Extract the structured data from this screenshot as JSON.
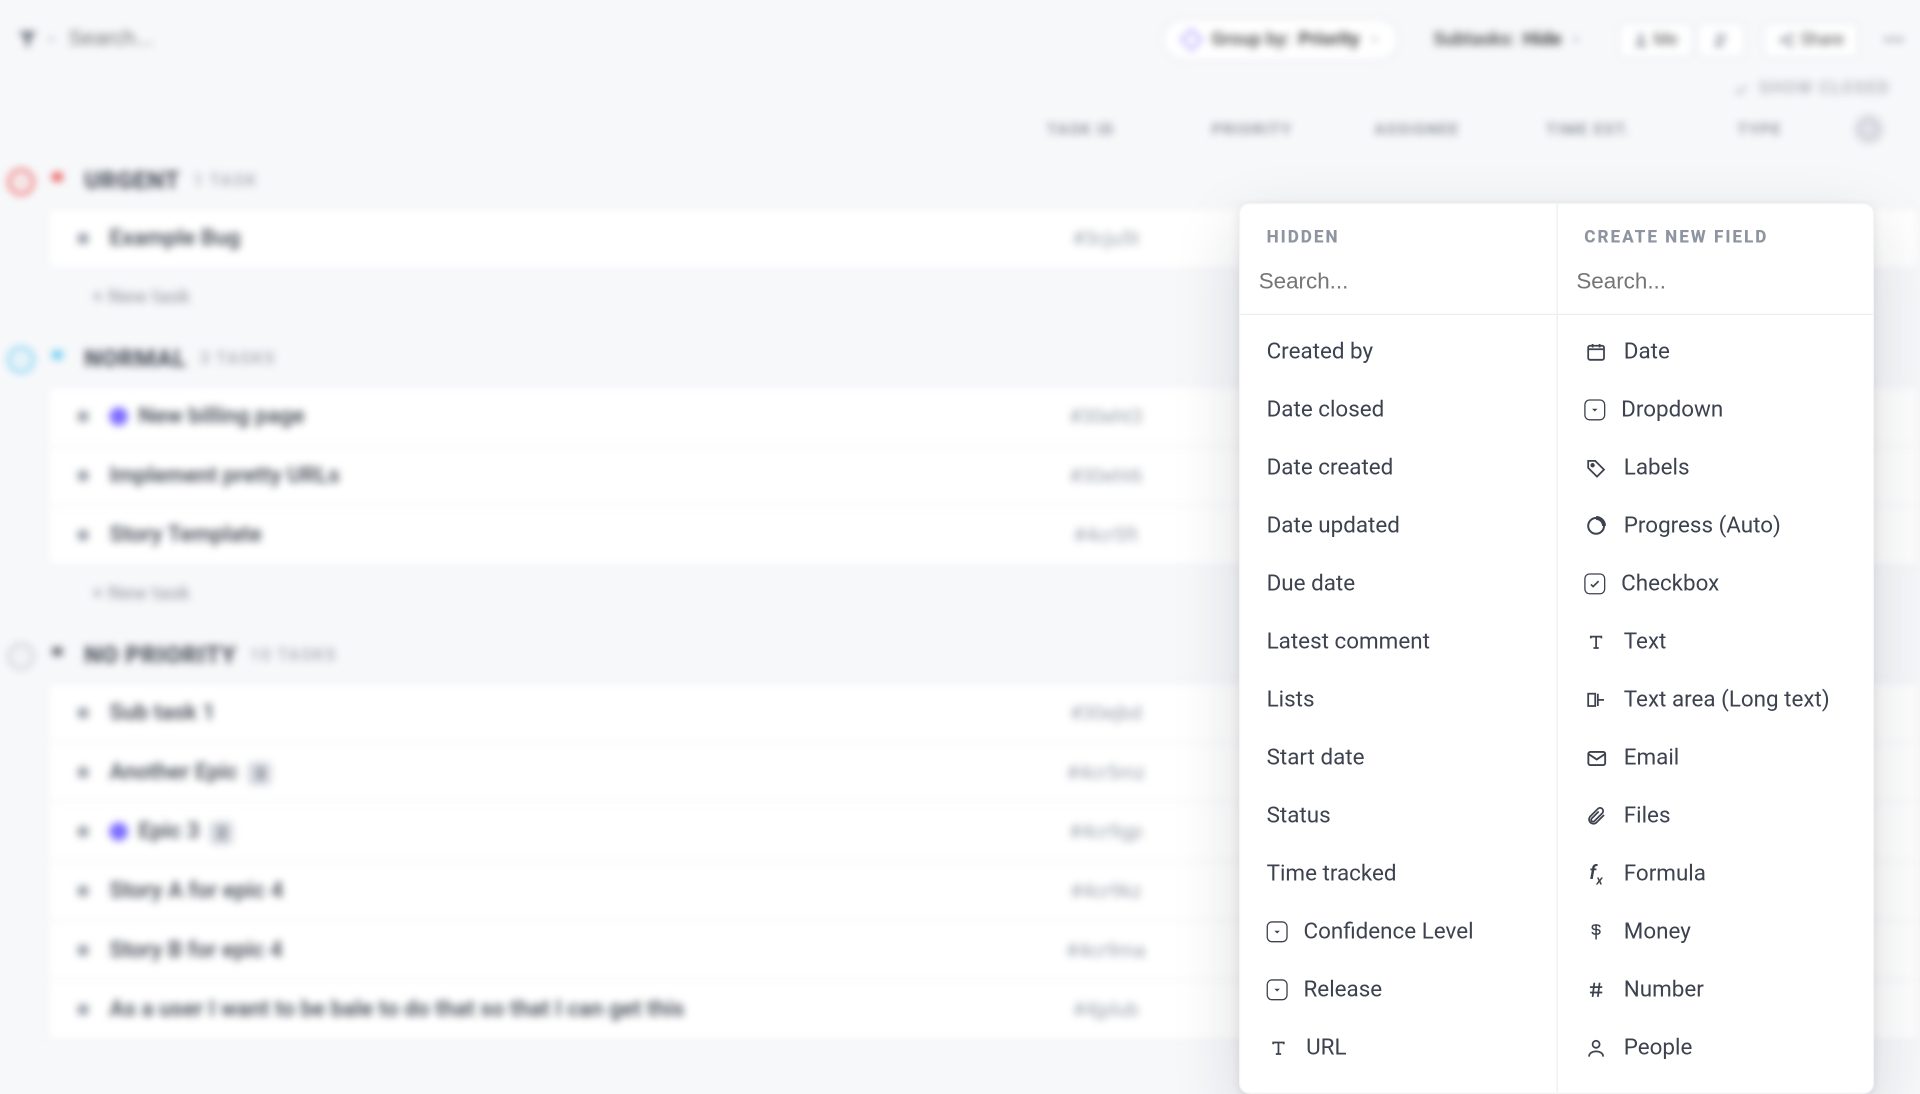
{
  "toolbar": {
    "search_placeholder": "Search...",
    "group_by_label": "Group by:",
    "group_by_value": "Priority",
    "subtasks_label": "Subtasks:",
    "subtasks_value": "Hide",
    "me": "Me",
    "share": "Share"
  },
  "subbar": {
    "show_closed": "SHOW CLOSED"
  },
  "columns": {
    "task_id": "TASK ID",
    "priority": "PRIORITY",
    "assignee": "ASSIGNEE",
    "time_est": "TIME EST.",
    "type": "TYPE"
  },
  "groups": [
    {
      "name": "URGENT",
      "count_label": "1 TASK",
      "flag": "red",
      "tasks": [
        {
          "title": "Example Bug",
          "id": "#3cju5t",
          "flag": "red",
          "badge": null,
          "dot": false
        }
      ]
    },
    {
      "name": "NORMAL",
      "count_label": "3 TASKS",
      "flag": "cyan",
      "tasks": [
        {
          "title": "New billing page",
          "id": "#30eht3",
          "flag": "cyan",
          "badge": null,
          "dot": true
        },
        {
          "title": "Implement pretty URLs",
          "id": "#30eht6",
          "flag": "cyan",
          "badge": null,
          "dot": false
        },
        {
          "title": "Story Template",
          "id": "#4cr5ft",
          "flag": "cyan",
          "badge": null,
          "dot": false
        }
      ]
    },
    {
      "name": "NO PRIORITY",
      "count_label": "10 TASKS",
      "flag": "grey",
      "tasks": [
        {
          "title": "Sub task 1",
          "id": "#30ejbd",
          "flag": "grey-outline",
          "badge": null,
          "dot": false
        },
        {
          "title": "Another Epic",
          "id": "#4cr5mz",
          "flag": "grey-outline",
          "badge": "3",
          "dot": false
        },
        {
          "title": "Epic 3",
          "id": "#4cr9gp",
          "flag": "grey-outline",
          "badge": "2",
          "dot": true
        },
        {
          "title": "Story A for epic 4",
          "id": "#4cr9kz",
          "flag": "grey-outline",
          "badge": null,
          "dot": false
        },
        {
          "title": "Story B for epic 4",
          "id": "#4cr9ma",
          "flag": "grey-outline",
          "badge": null,
          "dot": false
        },
        {
          "title": "As a user I want to be bale to do that so that I can get this",
          "id": "#4jplub",
          "flag": "grey-outline",
          "badge": null,
          "dot": false
        }
      ]
    }
  ],
  "new_task_label": "+ New task",
  "popover": {
    "hidden": {
      "title": "HIDDEN",
      "search_placeholder": "Search...",
      "items": [
        {
          "label": "Created by",
          "icon": null
        },
        {
          "label": "Date closed",
          "icon": null
        },
        {
          "label": "Date created",
          "icon": null
        },
        {
          "label": "Date updated",
          "icon": null
        },
        {
          "label": "Due date",
          "icon": null
        },
        {
          "label": "Latest comment",
          "icon": null
        },
        {
          "label": "Lists",
          "icon": null
        },
        {
          "label": "Start date",
          "icon": null
        },
        {
          "label": "Status",
          "icon": null
        },
        {
          "label": "Time tracked",
          "icon": null
        },
        {
          "label": "Confidence Level",
          "icon": "dropdown-box"
        },
        {
          "label": "Release",
          "icon": "dropdown-box"
        },
        {
          "label": "URL",
          "icon": "text-T"
        }
      ]
    },
    "create": {
      "title": "CREATE NEW FIELD",
      "search_placeholder": "Search...",
      "items": [
        {
          "label": "Date",
          "icon": "calendar"
        },
        {
          "label": "Dropdown",
          "icon": "dropdown-box"
        },
        {
          "label": "Labels",
          "icon": "tag"
        },
        {
          "label": "Progress (Auto)",
          "icon": "progress"
        },
        {
          "label": "Checkbox",
          "icon": "checkbox"
        },
        {
          "label": "Text",
          "icon": "text-T"
        },
        {
          "label": "Text area (Long text)",
          "icon": "textarea"
        },
        {
          "label": "Email",
          "icon": "mail"
        },
        {
          "label": "Files",
          "icon": "clip"
        },
        {
          "label": "Formula",
          "icon": "fx"
        },
        {
          "label": "Money",
          "icon": "dollar"
        },
        {
          "label": "Number",
          "icon": "hash"
        },
        {
          "label": "People",
          "icon": "person"
        }
      ]
    }
  }
}
